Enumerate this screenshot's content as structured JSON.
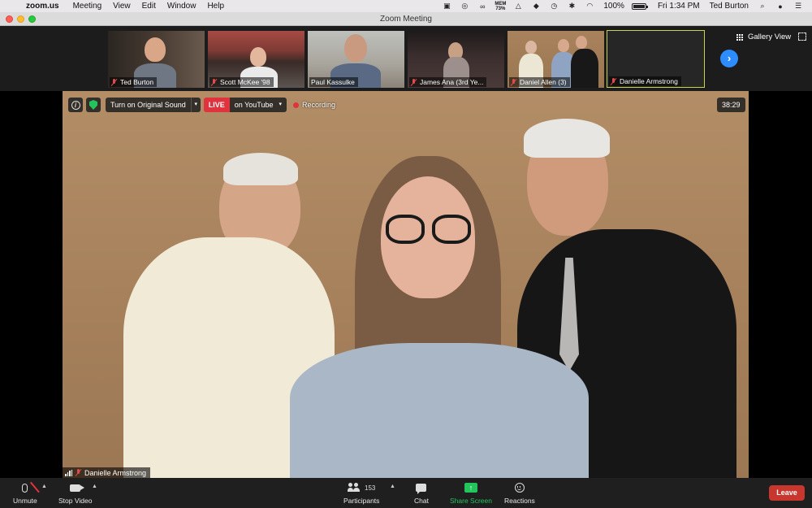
{
  "menubar": {
    "app_name": "zoom.us",
    "menus": [
      "Meeting",
      "View",
      "Edit",
      "Window",
      "Help"
    ],
    "mem_label": "MEM",
    "mem_value": "73%",
    "battery": "100%",
    "battery_level": 1.0,
    "clock": "Fri 1:34 PM",
    "user": "Ted Burton"
  },
  "window": {
    "title": "Zoom Meeting"
  },
  "gallery": {
    "view_label": "Gallery View",
    "tiles": [
      {
        "name": "Ted Burton"
      },
      {
        "name": "Scott McKee '98"
      },
      {
        "name": "Paul Kassulke"
      },
      {
        "name": "James Ana (3rd Ye..."
      },
      {
        "name": "Daniel Allen (3)"
      },
      {
        "name": "Danielle Armstrong"
      }
    ]
  },
  "stage": {
    "original_sound_label": "Turn on Original Sound",
    "live_label": "LIVE",
    "youtube_label": "on YouTube",
    "recording_label": "Recording",
    "timer": "38:29",
    "active_speaker": "Danielle Armstrong"
  },
  "toolbar": {
    "unmute": "Unmute",
    "stop_video": "Stop Video",
    "participants": "Participants",
    "participant_count": "153",
    "chat": "Chat",
    "share_screen": "Share Screen",
    "reactions": "Reactions",
    "leave": "Leave"
  },
  "colors": {
    "accent_blue": "#2d8cff",
    "live_red": "#e0333d",
    "share_green": "#23c45c",
    "leave_red": "#c8372d",
    "active_tile_border": "#c9d24a"
  }
}
